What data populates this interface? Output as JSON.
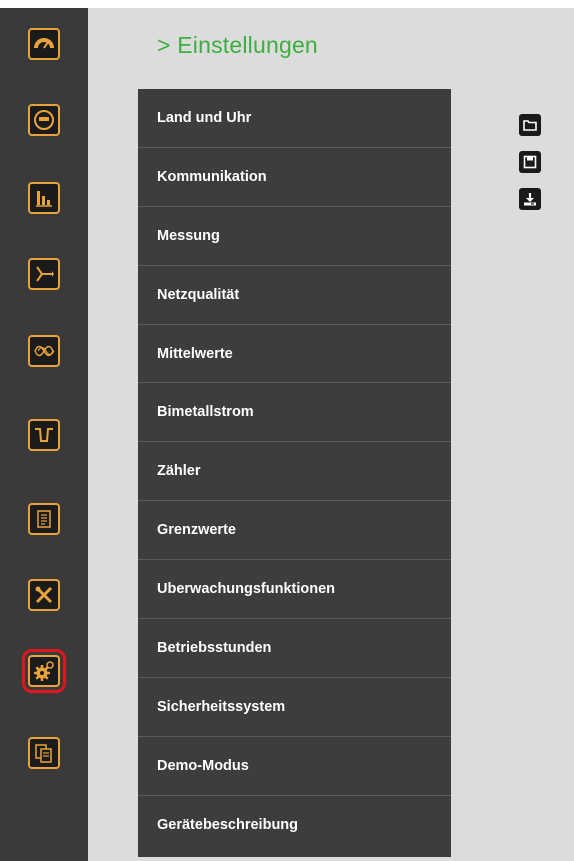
{
  "header": {
    "title": "> Einstellungen"
  },
  "sidebar": {
    "items": [
      {
        "icon": "dashboard-gauge-icon"
      },
      {
        "icon": "meter-icon"
      },
      {
        "icon": "bar-chart-icon"
      },
      {
        "icon": "vector-diagram-icon"
      },
      {
        "icon": "sine-wave-icon"
      },
      {
        "icon": "dip-waveform-icon"
      },
      {
        "icon": "report-list-icon"
      },
      {
        "icon": "tools-icon"
      },
      {
        "icon": "settings-gears-icon",
        "active": true
      },
      {
        "icon": "documents-icon"
      }
    ]
  },
  "menu": {
    "items": [
      {
        "label": "Land und Uhr"
      },
      {
        "label": "Kommunikation"
      },
      {
        "label": "Messung"
      },
      {
        "label": "Netzqualität"
      },
      {
        "label": "Mittelwerte"
      },
      {
        "label": "Bimetallstrom"
      },
      {
        "label": "Zähler"
      },
      {
        "label": "Grenzwerte"
      },
      {
        "label": "Uberwachungsfunktionen"
      },
      {
        "label": "Betriebsstunden"
      },
      {
        "label": "Sicherheitssystem"
      },
      {
        "label": "Demo-Modus"
      },
      {
        "label": "Gerätebeschreibung"
      }
    ]
  },
  "toolbar": {
    "items": [
      {
        "icon": "folder-open-icon"
      },
      {
        "icon": "save-icon"
      },
      {
        "icon": "download-icon"
      }
    ]
  },
  "colors": {
    "sidebar_bg": "#3a3a3a",
    "icon_accent": "#e8a43a",
    "active_outline": "#e0161c",
    "title_green": "#3dae3f",
    "menu_bg": "#3d3d3d",
    "content_bg": "#dcdcdc"
  }
}
